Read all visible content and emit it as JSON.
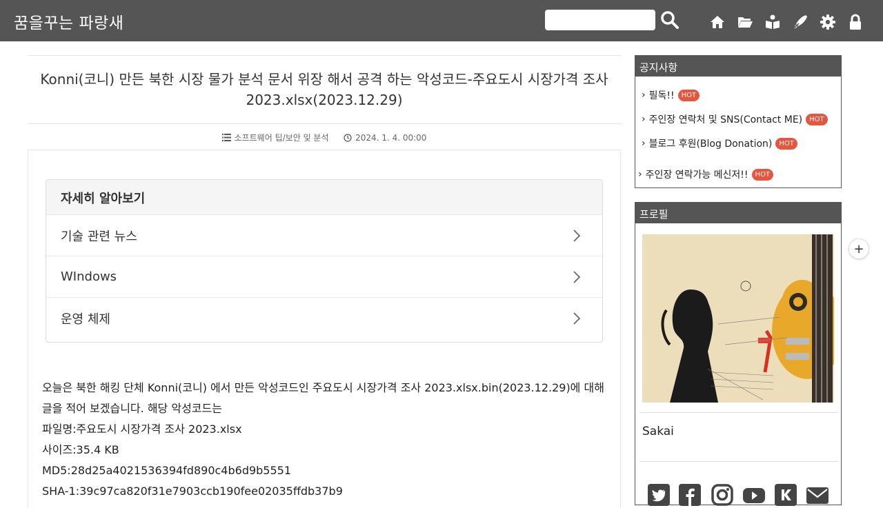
{
  "header": {
    "site_title": "꿈을꾸는 파랑새",
    "search": {
      "value": "",
      "placeholder": ""
    },
    "nav_icons": [
      "home-icon",
      "folder-icon",
      "guestbook-icon",
      "write-icon",
      "settings-icon",
      "lock-icon"
    ]
  },
  "post": {
    "title": "Konni(코니) 만든 북한 시장 물가 분석 문서 위장 해서 공격 하는 악성코드-주요도시 시장가격 조사 2023.xlsx(2023.12.29)",
    "category": "소프트웨어 팁/보안 및 분석",
    "date": "2024. 1. 4. 00:00"
  },
  "related": {
    "heading": "자세히 알아보기",
    "items": [
      {
        "label": "기술 관련 뉴스"
      },
      {
        "label": "WIndows"
      },
      {
        "label": "운영 체제"
      }
    ]
  },
  "body": {
    "lines": [
      "오늘은 북한 해킹 단체 Konni(코니) 에서 만든 악성코드인 주요도시 시장가격 조사 2023.xlsx.bin(2023.12.29)에 대해 글을 적어 보겠습니다. 해당 악성코드는",
      "파일명:주요도시 시장가격 조사 2023.xlsx",
      "사이즈:35.4 KB",
      "MD5:28d25a4021536394fd890c4b6d9b5551",
      "SHA-1:39c97ca820f31e7903ccb190fee02035ffdb37b9"
    ]
  },
  "sidebar": {
    "notice": {
      "heading": "공지사항",
      "hot_label": "HOT",
      "items": [
        {
          "label": "필독!!"
        },
        {
          "label": "주인장 연락처 및 SNS(Contact ME)"
        },
        {
          "label": "블로그 후원(Blog Donation)"
        },
        {
          "label": "주인장 연락가능 메신저!!"
        }
      ]
    },
    "profile": {
      "heading": "프로필",
      "name": "Sakai",
      "sns_icons": [
        "twitter-icon",
        "facebook-icon",
        "instagram-icon",
        "youtube-icon",
        "kakao-icon",
        "mail-icon"
      ]
    }
  },
  "floating": {
    "plus_label": "+"
  },
  "colors": {
    "header_bg": "#555555",
    "hot_badge": "#e8553f",
    "widget_border": "#555555"
  }
}
